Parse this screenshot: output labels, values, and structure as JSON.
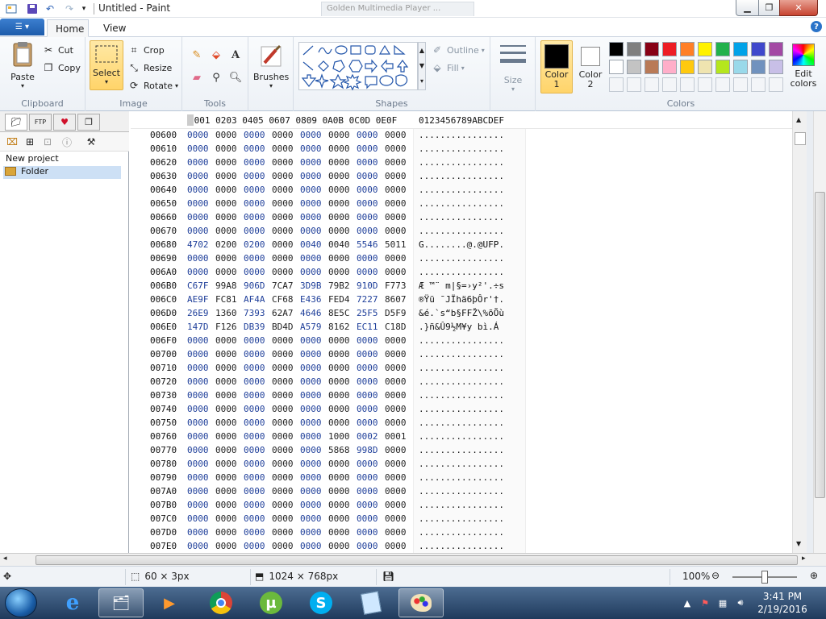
{
  "window": {
    "title": "Untitled - Paint",
    "ghost_tabs": [
      "Golden Multimedia Player ..."
    ]
  },
  "ribbon_tabs": {
    "home": "Home",
    "view": "View"
  },
  "clipboard": {
    "paste": "Paste",
    "cut": "Cut",
    "copy": "Copy",
    "label": "Clipboard"
  },
  "image": {
    "select": "Select",
    "crop": "Crop",
    "resize": "Resize",
    "rotate": "Rotate",
    "label": "Image"
  },
  "tools": {
    "label": "Tools"
  },
  "brushes": {
    "label": "Brushes"
  },
  "shapes": {
    "outline": "Outline",
    "fill": "Fill",
    "label": "Shapes"
  },
  "size": {
    "label": "Size"
  },
  "colors": {
    "color1": "Color 1",
    "color1_lines": [
      "Color",
      "1"
    ],
    "color2_lines": [
      "Color",
      "2"
    ],
    "edit_lines": [
      "Edit",
      "colors"
    ],
    "label": "Colors",
    "color1_value": "#000000",
    "color2_value": "#ffffff",
    "palette_row1": [
      "#000000",
      "#7f7f7f",
      "#880015",
      "#ed1c24",
      "#ff7f27",
      "#fff200",
      "#22b14c",
      "#00a2e8",
      "#3f48cc",
      "#a349a4"
    ],
    "palette_row2": [
      "#ffffff",
      "#c3c3c3",
      "#b97a57",
      "#ffaec9",
      "#ffc90e",
      "#efe4b0",
      "#b5e61d",
      "#99d9ea",
      "#7092be",
      "#c8bfe7"
    ]
  },
  "left_panel": {
    "tree": [
      {
        "label": "New project"
      },
      {
        "label": "Folder"
      }
    ]
  },
  "hex": {
    "header_cols": "0001 0203 0405 0607 0809 0A0B 0C0D 0E0F",
    "header_ascii": "0123456789ABCDEF",
    "rows": [
      {
        "off": "00600",
        "w": [
          "0000",
          "0000",
          "0000",
          "0000",
          "0000",
          "0000",
          "0000",
          "0000"
        ],
        "a": "................"
      },
      {
        "off": "00610",
        "w": [
          "0000",
          "0000",
          "0000",
          "0000",
          "0000",
          "0000",
          "0000",
          "0000"
        ],
        "a": "................"
      },
      {
        "off": "00620",
        "w": [
          "0000",
          "0000",
          "0000",
          "0000",
          "0000",
          "0000",
          "0000",
          "0000"
        ],
        "a": "................"
      },
      {
        "off": "00630",
        "w": [
          "0000",
          "0000",
          "0000",
          "0000",
          "0000",
          "0000",
          "0000",
          "0000"
        ],
        "a": "................"
      },
      {
        "off": "00640",
        "w": [
          "0000",
          "0000",
          "0000",
          "0000",
          "0000",
          "0000",
          "0000",
          "0000"
        ],
        "a": "................"
      },
      {
        "off": "00650",
        "w": [
          "0000",
          "0000",
          "0000",
          "0000",
          "0000",
          "0000",
          "0000",
          "0000"
        ],
        "a": "................"
      },
      {
        "off": "00660",
        "w": [
          "0000",
          "0000",
          "0000",
          "0000",
          "0000",
          "0000",
          "0000",
          "0000"
        ],
        "a": "................"
      },
      {
        "off": "00670",
        "w": [
          "0000",
          "0000",
          "0000",
          "0000",
          "0000",
          "0000",
          "0000",
          "0000"
        ],
        "a": "................"
      },
      {
        "off": "00680",
        "w": [
          "4702",
          "0200",
          "0200",
          "0000",
          "0040",
          "0040",
          "5546",
          "5011"
        ],
        "a": "G........@.@UFP."
      },
      {
        "off": "00690",
        "w": [
          "0000",
          "0000",
          "0000",
          "0000",
          "0000",
          "0000",
          "0000",
          "0000"
        ],
        "a": "................"
      },
      {
        "off": "006A0",
        "w": [
          "0000",
          "0000",
          "0000",
          "0000",
          "0000",
          "0000",
          "0000",
          "0000"
        ],
        "a": "................"
      },
      {
        "off": "006B0",
        "w": [
          "C67F",
          "99A8",
          "906D",
          "7CA7",
          "3D9B",
          "79B2",
          "910D",
          "F773"
        ],
        "a": "Æ ™¨ m|§=›y²'.÷s"
      },
      {
        "off": "006C0",
        "w": [
          "AE9F",
          "FC81",
          "AF4A",
          "CF68",
          "E436",
          "FED4",
          "7227",
          "8607"
        ],
        "a": "®Ÿü ¯JÏhä6þÔr'†."
      },
      {
        "off": "006D0",
        "w": [
          "26E9",
          "1360",
          "7393",
          "62A7",
          "4646",
          "8E5C",
          "25F5",
          "D5F9"
        ],
        "a": "&é.`s“b§FFŽ\\%õÕù"
      },
      {
        "off": "006E0",
        "w": [
          "147D",
          "F126",
          "DB39",
          "BD4D",
          "A579",
          "8162",
          "EC11",
          "C18D"
        ],
        "a": ".}ñ&Û9½M¥y bì.Á"
      },
      {
        "off": "006F0",
        "w": [
          "0000",
          "0000",
          "0000",
          "0000",
          "0000",
          "0000",
          "0000",
          "0000"
        ],
        "a": "................"
      },
      {
        "off": "00700",
        "w": [
          "0000",
          "0000",
          "0000",
          "0000",
          "0000",
          "0000",
          "0000",
          "0000"
        ],
        "a": "................"
      },
      {
        "off": "00710",
        "w": [
          "0000",
          "0000",
          "0000",
          "0000",
          "0000",
          "0000",
          "0000",
          "0000"
        ],
        "a": "................"
      },
      {
        "off": "00720",
        "w": [
          "0000",
          "0000",
          "0000",
          "0000",
          "0000",
          "0000",
          "0000",
          "0000"
        ],
        "a": "................"
      },
      {
        "off": "00730",
        "w": [
          "0000",
          "0000",
          "0000",
          "0000",
          "0000",
          "0000",
          "0000",
          "0000"
        ],
        "a": "................"
      },
      {
        "off": "00740",
        "w": [
          "0000",
          "0000",
          "0000",
          "0000",
          "0000",
          "0000",
          "0000",
          "0000"
        ],
        "a": "................"
      },
      {
        "off": "00750",
        "w": [
          "0000",
          "0000",
          "0000",
          "0000",
          "0000",
          "0000",
          "0000",
          "0000"
        ],
        "a": "................"
      },
      {
        "off": "00760",
        "w": [
          "0000",
          "0000",
          "0000",
          "0000",
          "0000",
          "1000",
          "0002",
          "0001"
        ],
        "a": "................"
      },
      {
        "off": "00770",
        "w": [
          "0000",
          "0000",
          "0000",
          "0000",
          "0000",
          "5868",
          "998D",
          "0000"
        ],
        "a": "................"
      },
      {
        "off": "00780",
        "w": [
          "0000",
          "0000",
          "0000",
          "0000",
          "0000",
          "0000",
          "0000",
          "0000"
        ],
        "a": "................"
      },
      {
        "off": "00790",
        "w": [
          "0000",
          "0000",
          "0000",
          "0000",
          "0000",
          "0000",
          "0000",
          "0000"
        ],
        "a": "................"
      },
      {
        "off": "007A0",
        "w": [
          "0000",
          "0000",
          "0000",
          "0000",
          "0000",
          "0000",
          "0000",
          "0000"
        ],
        "a": "................"
      },
      {
        "off": "007B0",
        "w": [
          "0000",
          "0000",
          "0000",
          "0000",
          "0000",
          "0000",
          "0000",
          "0000"
        ],
        "a": "................"
      },
      {
        "off": "007C0",
        "w": [
          "0000",
          "0000",
          "0000",
          "0000",
          "0000",
          "0000",
          "0000",
          "0000"
        ],
        "a": "................"
      },
      {
        "off": "007D0",
        "w": [
          "0000",
          "0000",
          "0000",
          "0000",
          "0000",
          "0000",
          "0000",
          "0000"
        ],
        "a": "................"
      },
      {
        "off": "007E0",
        "w": [
          "0000",
          "0000",
          "0000",
          "0000",
          "0000",
          "0000",
          "0000",
          "0000"
        ],
        "a": "................"
      }
    ]
  },
  "status": {
    "selection": "60 × 3px",
    "canvas": "1024 × 768px",
    "zoom": "100%",
    "zoom_level": 0.5
  },
  "taskbar": {
    "time": "3:41 PM",
    "date": "2/19/2016"
  }
}
